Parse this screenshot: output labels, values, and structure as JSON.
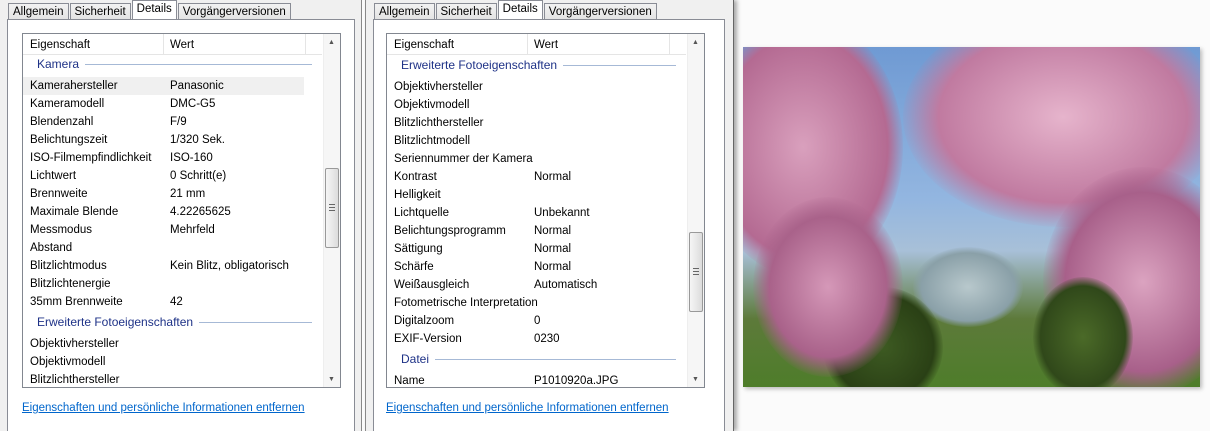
{
  "tabs": [
    "Allgemein",
    "Sicherheit",
    "Details",
    "Vorgängerversionen"
  ],
  "header": {
    "property": "Eigenschaft",
    "value": "Wert"
  },
  "left_list": {
    "groups": [
      {
        "title": "Kamera",
        "rows": [
          [
            "Kamerahersteller",
            "Panasonic"
          ],
          [
            "Kameramodell",
            "DMC-G5"
          ],
          [
            "Blendenzahl",
            "F/9"
          ],
          [
            "Belichtungszeit",
            "1/320 Sek."
          ],
          [
            "ISO-Filmempfindlichkeit",
            "ISO-160"
          ],
          [
            "Lichtwert",
            "0 Schritt(e)"
          ],
          [
            "Brennweite",
            "21 mm"
          ],
          [
            "Maximale Blende",
            "4.22265625"
          ],
          [
            "Messmodus",
            "Mehrfeld"
          ],
          [
            "Abstand",
            ""
          ],
          [
            "Blitzlichtmodus",
            "Kein Blitz, obligatorisch"
          ],
          [
            "Blitzlichtenergie",
            ""
          ],
          [
            "35mm Brennweite",
            "42"
          ]
        ]
      },
      {
        "title": "Erweiterte Fotoeigenschaften",
        "rows": [
          [
            "Objektivhersteller",
            ""
          ],
          [
            "Objektivmodell",
            ""
          ],
          [
            "Blitzlichthersteller",
            ""
          ]
        ]
      }
    ],
    "scroll_position": 0.45
  },
  "right_list": {
    "groups": [
      {
        "title": "Erweiterte Fotoeigenschaften",
        "rows": [
          [
            "Objektivhersteller",
            ""
          ],
          [
            "Objektivmodell",
            ""
          ],
          [
            "Blitzlichthersteller",
            ""
          ],
          [
            "Blitzlichtmodell",
            ""
          ],
          [
            "Seriennummer der Kamera",
            ""
          ],
          [
            "Kontrast",
            "Normal"
          ],
          [
            "Helligkeit",
            ""
          ],
          [
            "Lichtquelle",
            "Unbekannt"
          ],
          [
            "Belichtungsprogramm",
            "Normal"
          ],
          [
            "Sättigung",
            "Normal"
          ],
          [
            "Schärfe",
            "Normal"
          ],
          [
            "Weißausgleich",
            "Automatisch"
          ],
          [
            "Fotometrische Interpretation",
            ""
          ],
          [
            "Digitalzoom",
            "0"
          ],
          [
            "EXIF-Version",
            "0230"
          ]
        ]
      },
      {
        "title": "Datei",
        "rows": [
          [
            "Name",
            "P1010920a.JPG"
          ]
        ]
      }
    ],
    "scroll_position": 0.66
  },
  "link": "Eigenschaften und persönliche Informationen entfernen",
  "colors": {
    "group_title": "#1e3287",
    "link": "#0066cc"
  }
}
